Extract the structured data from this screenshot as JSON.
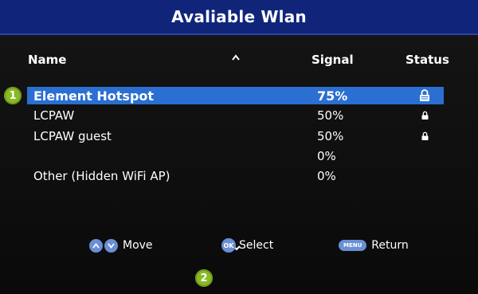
{
  "header": {
    "title": "Avaliable Wlan"
  },
  "columns": {
    "name": "Name",
    "signal": "Signal",
    "status": "Status"
  },
  "networks": [
    {
      "name": "Element Hotspot",
      "signal": "75%",
      "status_icon": "lock-icon",
      "selected": true
    },
    {
      "name": "LCPAW",
      "signal": "50%",
      "status_icon": "lock-icon",
      "selected": false
    },
    {
      "name": "LCPAW guest",
      "signal": "50%",
      "status_icon": "lock-icon",
      "selected": false
    },
    {
      "name": "",
      "signal": "0%",
      "status_icon": "",
      "selected": false
    },
    {
      "name": "Other (Hidden WiFi AP)",
      "signal": "0%",
      "status_icon": "",
      "selected": false
    }
  ],
  "footer": {
    "move_label": "Move",
    "ok_key": "OK",
    "select_label": "Select",
    "menu_key": "MENU",
    "return_label": "Return"
  },
  "markers": [
    "1",
    "2"
  ],
  "colors": {
    "title_bar": "#10257a",
    "selection": "#2a6fd1",
    "button": "#6a8fd6",
    "marker": "#8ab926"
  }
}
